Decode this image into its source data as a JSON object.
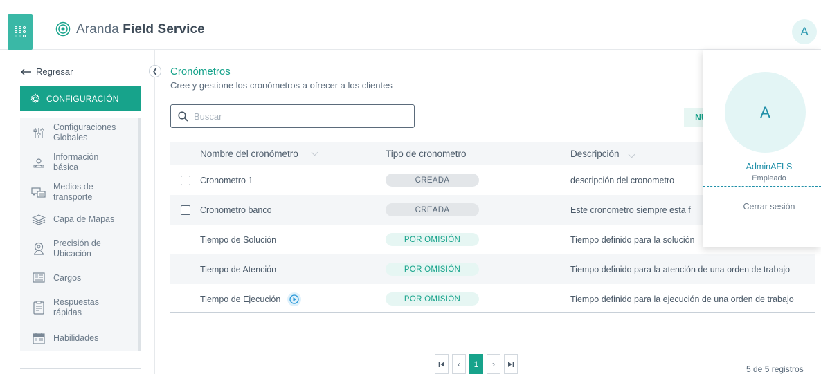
{
  "header": {
    "brand_light": "Aranda",
    "brand_bold": "Field Service",
    "user_initial": "A"
  },
  "sidebar": {
    "back_label": "Regresar",
    "section_label": "CONFIGURACIÓN",
    "items": [
      {
        "icon": "sliders-icon",
        "line1": "Configuraciones",
        "line2": "Globales"
      },
      {
        "icon": "id-card-icon",
        "line1": "Información",
        "line2": "básica"
      },
      {
        "icon": "transport-icon",
        "line1": "Medios de",
        "line2": "transporte"
      },
      {
        "icon": "layers-icon",
        "line1": "Capa de Mapas",
        "line2": ""
      },
      {
        "icon": "location-pin-icon",
        "line1": "Precisión de",
        "line2": "Ubicación"
      },
      {
        "icon": "badge-icon",
        "line1": "Cargos",
        "line2": ""
      },
      {
        "icon": "quick-reply-icon",
        "line1": "Respuestas",
        "line2": "rápidas"
      },
      {
        "icon": "calendar-icon",
        "line1": "Habilidades",
        "line2": ""
      }
    ]
  },
  "main": {
    "title": "Cronómetros",
    "subtitle": "Cree y gestione los cronómetros a ofrecer a los clientes",
    "search_placeholder": "Buscar",
    "new_button_label": "NU",
    "columns": {
      "name": "Nombre del cronómetro",
      "type": "Tipo de cronometro",
      "description": "Descripción"
    },
    "rows": [
      {
        "name": "Cronometro 1",
        "type": "CREADA",
        "description": "descripción del cronometro",
        "checkbox": true
      },
      {
        "name": "Cronometro banco",
        "type": "CREADA",
        "description": "Este cronometro siempre esta f",
        "checkbox": true
      },
      {
        "name": "Tiempo de Solución",
        "type": "POR OMISIÓN",
        "description": "Tiempo definido para la solución",
        "checkbox": false
      },
      {
        "name": "Tiempo de Atención",
        "type": "POR OMISIÓN",
        "description": "Tiempo definido para la atención de una orden de trabajo",
        "checkbox": false
      },
      {
        "name": "Tiempo de Ejecución",
        "type": "POR OMISIÓN",
        "description": "Tiempo definido para la ejecución de una orden de trabajo",
        "checkbox": false
      }
    ]
  },
  "pagination": {
    "current_page": "1",
    "records": "5 de 5 registros"
  },
  "user_menu": {
    "initial": "A",
    "name": "AdminAFLS",
    "role": "Empleado",
    "logout": "Cerrar sesión"
  },
  "colors": {
    "accent": "#17a38b",
    "apps_button": "#3ab8a6",
    "user_accent": "#1f8fa8"
  }
}
